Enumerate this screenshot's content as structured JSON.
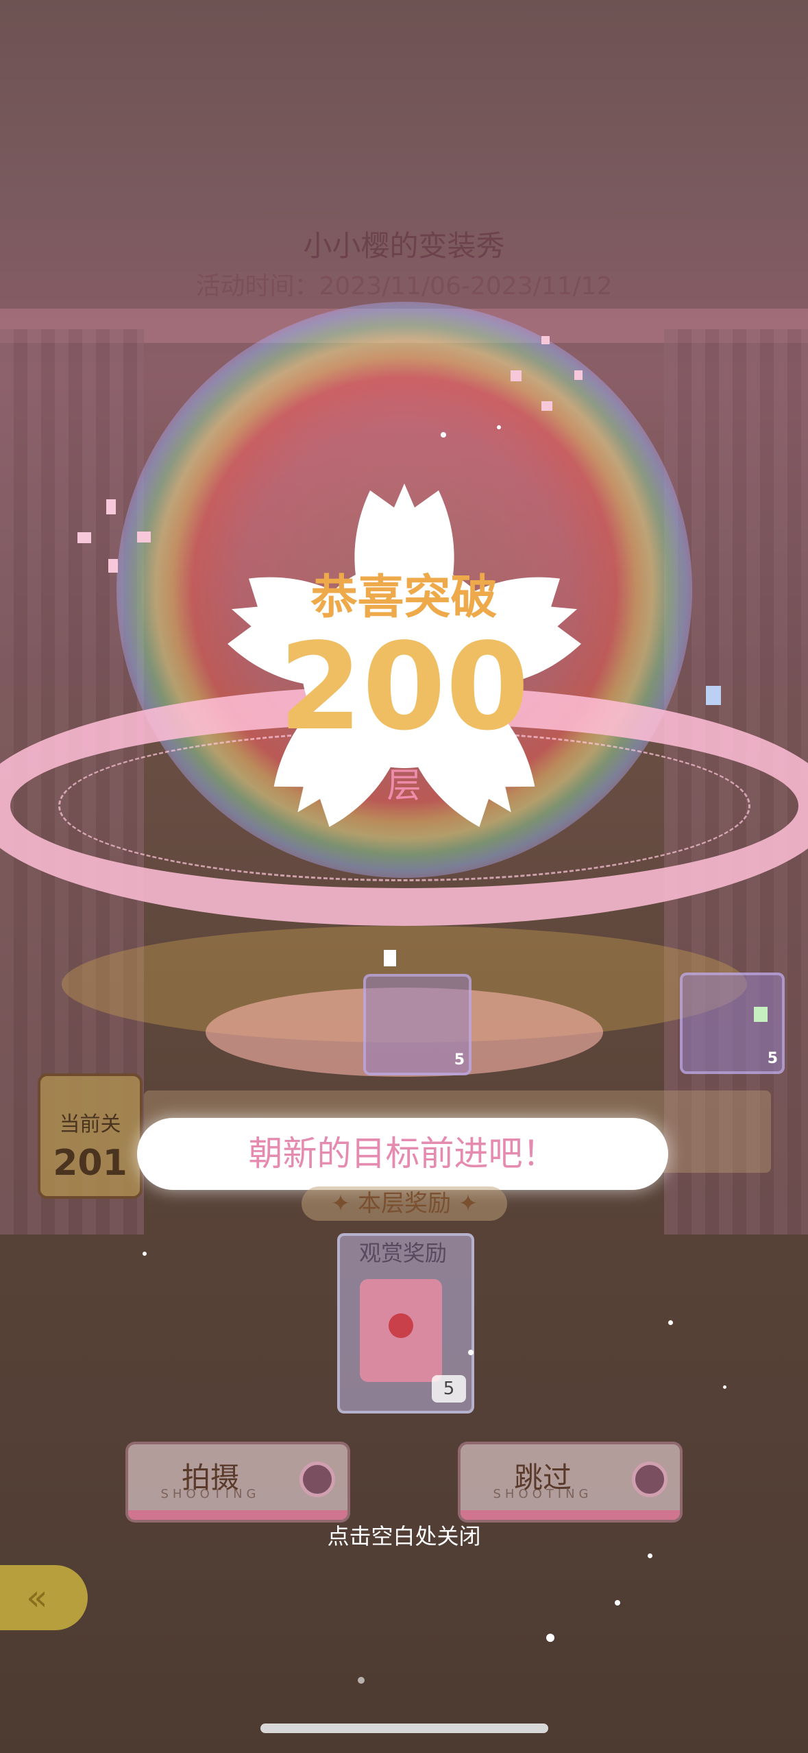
{
  "event": {
    "title": "小小樱的变装秀",
    "period": "活动时间：2023/11/06-2023/11/12"
  },
  "popup": {
    "congrats": "恭喜突破",
    "floor": "200",
    "unit": "层",
    "message": "朝新的目标前进吧！"
  },
  "stage": {
    "current_label": "当前关",
    "current_level": "201",
    "layer_reward_label": "✦ 本层奖励 ✦",
    "watch_reward_label": "观赏奖励",
    "watch_reward_count": "5",
    "item_count_left": "5",
    "item_count_right": "5"
  },
  "buttons": {
    "shoot_label": "拍摄",
    "shoot_sub": "SHOOTING",
    "skip_label": "跳过",
    "skip_sub": "SHOOTING"
  },
  "hint": "点击空白处关闭",
  "colors": {
    "congrats": "#eeaa4a",
    "floor_number": "#f0be62",
    "unit": "#ee8cab",
    "message": "#e58bb0"
  }
}
